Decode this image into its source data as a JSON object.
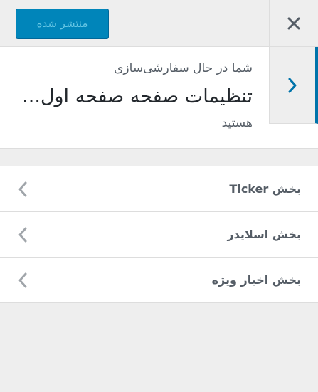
{
  "header": {
    "publish_label": "منتشر شده",
    "close_icon": "close-icon"
  },
  "info": {
    "line1": "شما در حال سفارشی‌سازی",
    "title": "تنظیمات صفحه صفحه اول...",
    "line3": "هستید",
    "back_icon": "chevron-right-icon"
  },
  "sections": [
    {
      "label": "بخش Ticker"
    },
    {
      "label": "بخش اسلایدر"
    },
    {
      "label": "بخش اخبار ویژه"
    }
  ],
  "colors": {
    "accent": "#0073aa",
    "button_bg": "#0085ba",
    "background": "#eeeeee",
    "panel": "#ffffff"
  }
}
